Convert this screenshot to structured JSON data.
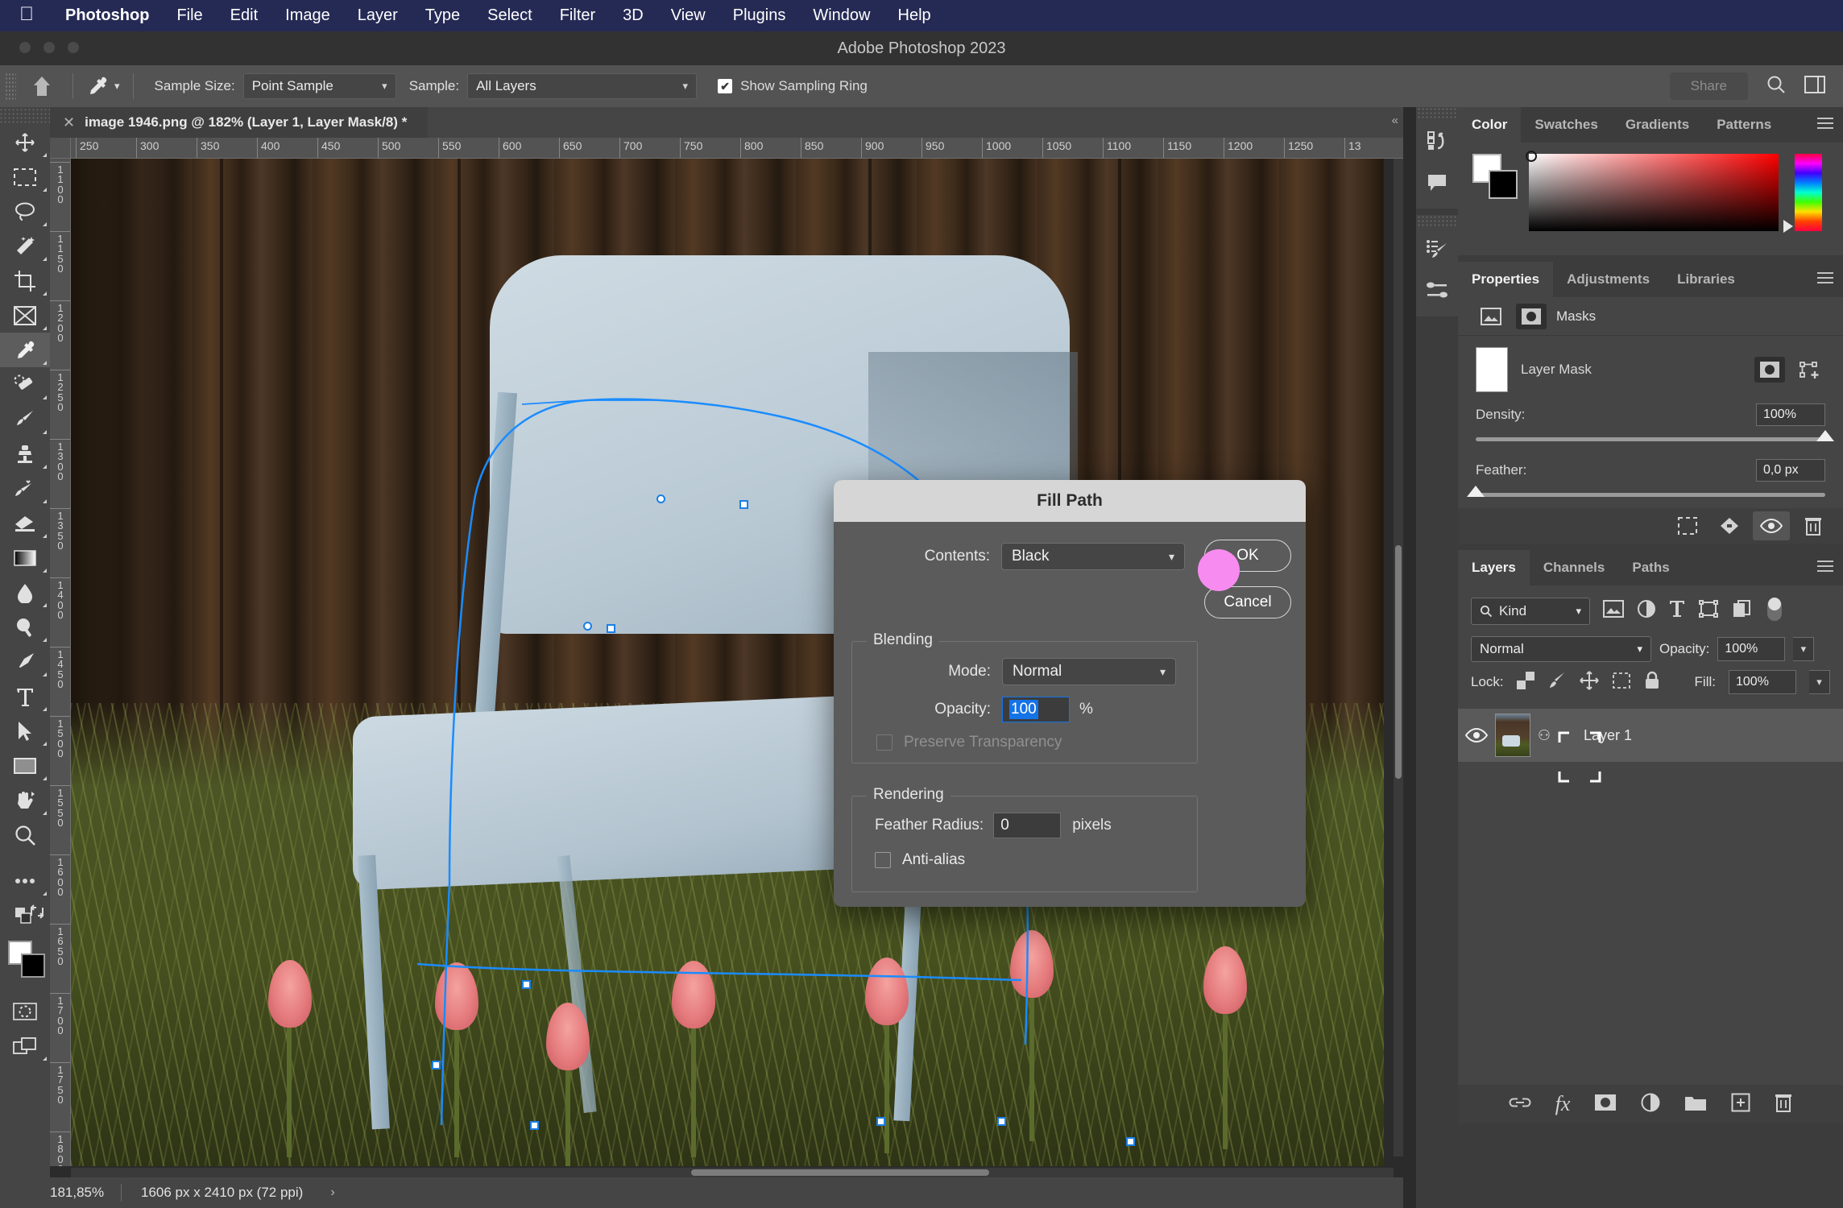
{
  "menubar": {
    "apple": "apple-logo",
    "items": [
      "Photoshop",
      "File",
      "Edit",
      "Image",
      "Layer",
      "Type",
      "Select",
      "Filter",
      "3D",
      "View",
      "Plugins",
      "Window",
      "Help"
    ]
  },
  "titlebar": {
    "title": "Adobe Photoshop 2023"
  },
  "options_bar": {
    "home_icon": "home-icon",
    "tool_icon": "eyedropper-icon",
    "sample_size_label": "Sample Size:",
    "sample_size_value": "Point Sample",
    "sample_label": "Sample:",
    "sample_value": "All Layers",
    "show_sampling_ring_label": "Show Sampling Ring",
    "show_sampling_ring_checked": true,
    "share_label": "Share"
  },
  "document_tab": {
    "title": "image 1946.png @ 182% (Layer 1, Layer Mask/8) *",
    "close_icon": "close-icon"
  },
  "toolbar": {
    "tools": [
      {
        "name": "move-tool",
        "selected": false
      },
      {
        "name": "rectangular-marquee-tool",
        "selected": false
      },
      {
        "name": "lasso-tool",
        "selected": false
      },
      {
        "name": "magic-wand-tool",
        "selected": false
      },
      {
        "name": "crop-tool",
        "selected": false
      },
      {
        "name": "frame-tool",
        "selected": false
      },
      {
        "name": "eyedropper-tool",
        "selected": true
      },
      {
        "name": "healing-brush-tool",
        "selected": false
      },
      {
        "name": "brush-tool",
        "selected": false
      },
      {
        "name": "clone-stamp-tool",
        "selected": false
      },
      {
        "name": "history-brush-tool",
        "selected": false
      },
      {
        "name": "eraser-tool",
        "selected": false
      },
      {
        "name": "gradient-tool",
        "selected": false
      },
      {
        "name": "blur-tool",
        "selected": false
      },
      {
        "name": "dodge-tool",
        "selected": false
      },
      {
        "name": "pen-tool",
        "selected": false
      },
      {
        "name": "type-tool",
        "selected": false
      },
      {
        "name": "path-selection-tool",
        "selected": false
      },
      {
        "name": "rectangle-tool",
        "selected": false
      },
      {
        "name": "hand-tool",
        "selected": false
      },
      {
        "name": "zoom-tool",
        "selected": false
      },
      {
        "name": "edit-toolbar-tool",
        "selected": false
      }
    ],
    "foreground_color": "#ffffff",
    "background_color": "#000000",
    "quick_mask_icon": "quick-mask-icon",
    "screen_mode_icon": "screen-mode-icon"
  },
  "rulers": {
    "horizontal_ticks": [
      "250",
      "300",
      "350",
      "400",
      "450",
      "500",
      "550",
      "600",
      "650",
      "700",
      "750",
      "800",
      "850",
      "900",
      "950",
      "1000",
      "1050",
      "1100",
      "1150",
      "1200",
      "1250",
      "13"
    ],
    "vertical_ticks": [
      "1100",
      "1150",
      "1200",
      "1250",
      "1300",
      "1350",
      "1400",
      "1450",
      "1500",
      "1550",
      "1600",
      "1650",
      "1700",
      "1750",
      "1800"
    ]
  },
  "dialog": {
    "title": "Fill Path",
    "contents_label": "Contents:",
    "contents_value": "Black",
    "ok_label": "OK",
    "cancel_label": "Cancel",
    "blending_legend": "Blending",
    "mode_label": "Mode:",
    "mode_value": "Normal",
    "opacity_label": "Opacity:",
    "opacity_value": "100",
    "opacity_unit": "%",
    "preserve_transparency_label": "Preserve Transparency",
    "preserve_transparency_checked": false,
    "rendering_legend": "Rendering",
    "feather_radius_label": "Feather Radius:",
    "feather_radius_value": "0",
    "feather_radius_unit": "pixels",
    "anti_alias_label": "Anti-alias",
    "anti_alias_checked": false,
    "cursor_color": "#f78bf0"
  },
  "color_panel": {
    "tabs": [
      "Color",
      "Swatches",
      "Gradients",
      "Patterns"
    ],
    "active_tab": "Color",
    "foreground": "#ffffff",
    "background": "#000000",
    "menu_icon": "panel-menu-icon"
  },
  "properties_panel": {
    "tabs": [
      "Properties",
      "Adjustments",
      "Libraries"
    ],
    "active_tab": "Properties",
    "section_label": "Masks",
    "pixel_mask_icon": "pixel-mask-icon",
    "vector_mask_icon": "vector-mask-icon",
    "mask_name": "Layer Mask",
    "density_label": "Density:",
    "density_value": "100%",
    "density_percent": 100,
    "feather_label": "Feather:",
    "feather_value": "0,0 px",
    "feather_percent": 0,
    "footer_icons": [
      "selection-from-mask-icon",
      "apply-mask-icon",
      "toggle-mask-icon",
      "delete-mask-icon"
    ]
  },
  "layers_panel": {
    "tabs": [
      "Layers",
      "Channels",
      "Paths"
    ],
    "active_tab": "Layers",
    "filter_label": "Kind",
    "filter_icons": [
      "pixel-filter-icon",
      "adjustment-filter-icon",
      "type-filter-icon",
      "shape-filter-icon",
      "smart-object-filter-icon"
    ],
    "blend_mode": "Normal",
    "opacity_label": "Opacity:",
    "opacity_value": "100%",
    "lock_label": "Lock:",
    "lock_icons": [
      "lock-transparency-icon",
      "lock-image-icon",
      "lock-position-icon",
      "lock-artboard-icon",
      "lock-all-icon"
    ],
    "fill_label": "Fill:",
    "fill_value": "100%",
    "layers": [
      {
        "name": "Layer 1",
        "visible": true,
        "has_mask": true,
        "mask_selected": true,
        "linked": true
      }
    ],
    "footer_icons": [
      "link-layers-icon",
      "fx-icon",
      "add-mask-icon",
      "adjustment-layer-icon",
      "new-group-icon",
      "new-layer-icon",
      "delete-layer-icon"
    ]
  },
  "dock_icons": [
    "history-icon",
    "comment-icon",
    "brush-settings-icon",
    "brush-presets-icon"
  ],
  "status_bar": {
    "zoom": "181,85%",
    "dimensions": "1606 px x 2410 px (72 ppi)",
    "expand_icon": "chevron-right-icon"
  }
}
